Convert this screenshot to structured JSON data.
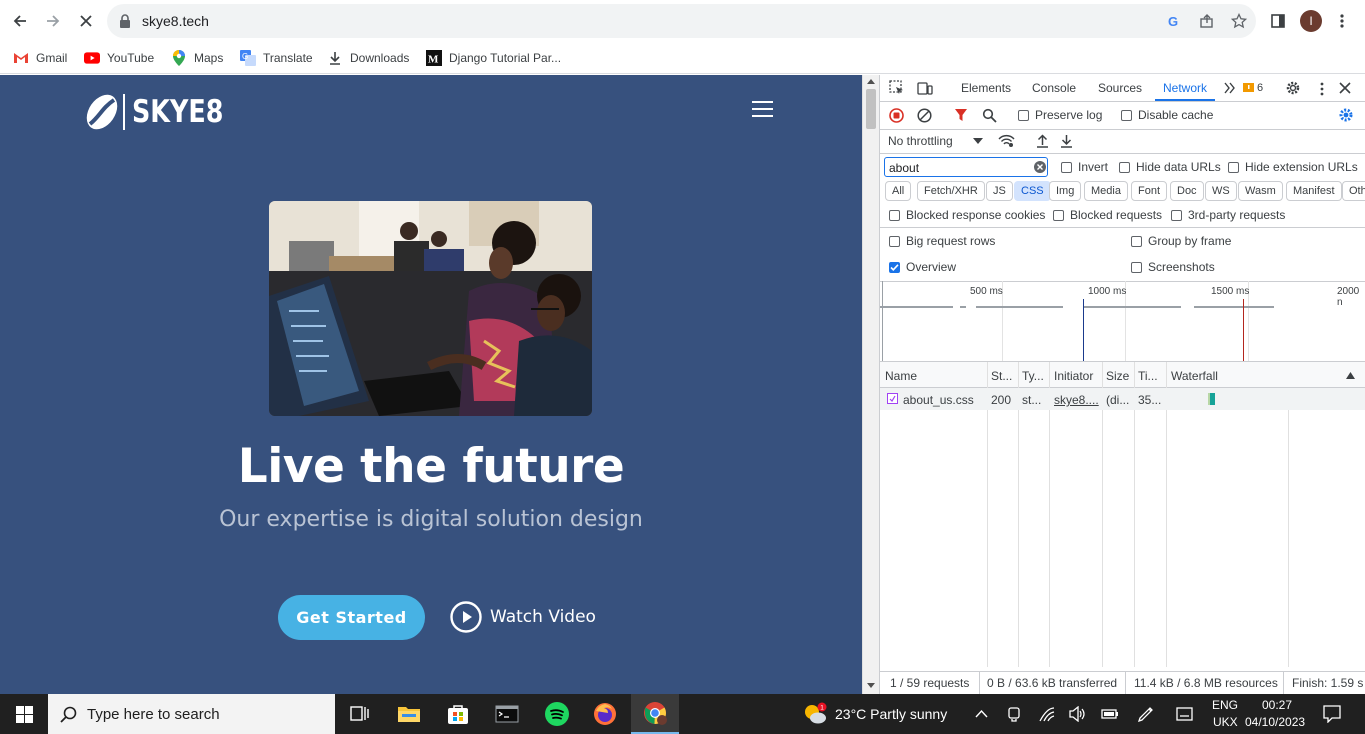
{
  "browser": {
    "url": "skye8.tech",
    "profile_initial": "I",
    "bookmarks": [
      "Gmail",
      "YouTube",
      "Maps",
      "Translate",
      "Downloads",
      "Django Tutorial Par..."
    ]
  },
  "page": {
    "logo": "SKYE8",
    "title": "Live the future",
    "subtitle": "Our expertise is digital solution design",
    "cta_primary": "Get Started",
    "cta_secondary": "Watch Video",
    "colors": {
      "background": "#37517e",
      "accent": "#47b2e4"
    }
  },
  "devtools": {
    "tabs": [
      "Elements",
      "Console",
      "Sources",
      "Network"
    ],
    "active_tab": "Network",
    "issues_count": "6",
    "preserve_log": "Preserve log",
    "disable_cache": "Disable cache",
    "throttling": "No throttling",
    "filter_value": "about",
    "invert": "Invert",
    "hide_data_urls": "Hide data URLs",
    "hide_extension_urls": "Hide extension URLs",
    "type_filters": [
      "All",
      "Fetch/XHR",
      "JS",
      "CSS",
      "Img",
      "Media",
      "Font",
      "Doc",
      "WS",
      "Wasm",
      "Manifest",
      "Oth"
    ],
    "selected_filter": "CSS",
    "blocked_response_cookies": "Blocked response cookies",
    "blocked_requests": "Blocked requests",
    "third_party_requests": "3rd-party requests",
    "big_request_rows": "Big request rows",
    "group_by_frame": "Group by frame",
    "overview": "Overview",
    "screenshots": "Screenshots",
    "timeline_ticks": [
      "500 ms",
      "1000 ms",
      "1500 ms",
      "2000 n"
    ],
    "columns": [
      "Name",
      "St...",
      "Ty...",
      "Initiator",
      "Size",
      "Ti...",
      "Waterfall"
    ],
    "rows": [
      {
        "name": "about_us.css",
        "status": "200",
        "type": "st...",
        "initiator": "skye8....",
        "size": "(di...",
        "time": "35..."
      }
    ],
    "status": {
      "requests": "1 / 59 requests",
      "transferred": "0 B / 63.6 kB transferred",
      "resources": "11.4 kB / 6.8 MB resources",
      "finish": "Finish: 1.59 s"
    }
  },
  "taskbar": {
    "search_placeholder": "Type here to search",
    "weather": "23°C  Partly sunny",
    "lang": "ENG",
    "layout": "UKX",
    "time": "00:27",
    "date": "04/10/2023"
  }
}
